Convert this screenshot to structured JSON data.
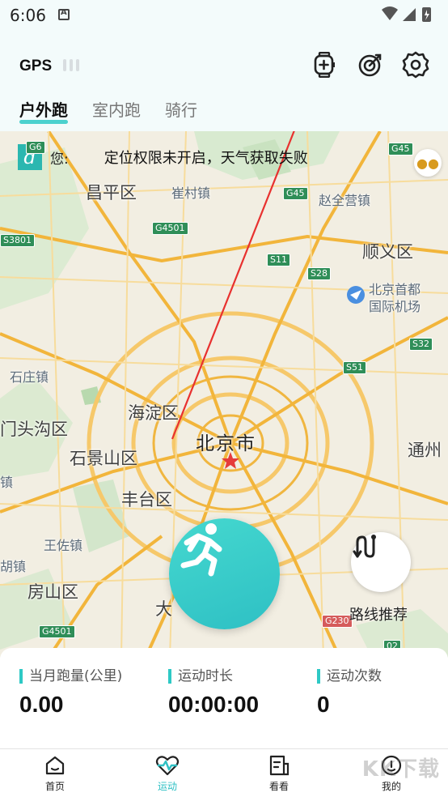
{
  "status_bar": {
    "time": "6:06"
  },
  "header": {
    "gps_label": "GPS",
    "tabs": [
      {
        "label": "户外跑",
        "active": true
      },
      {
        "label": "室内跑",
        "active": false
      },
      {
        "label": "骑行",
        "active": false
      }
    ],
    "icons": [
      "watch-add-icon",
      "target-icon",
      "settings-icon"
    ]
  },
  "map": {
    "weather_prefix": "您:",
    "weather_message": "定位权限未开启，天气获取失败",
    "city": "北京市",
    "districts": [
      "昌平区",
      "顺义区",
      "海淀区",
      "门头沟区",
      "石景山区",
      "丰台区",
      "房山区",
      "通州",
      "大"
    ],
    "towns": [
      "崔村镇",
      "赵全营镇",
      "北京首都",
      "国际机场",
      "王佐镇",
      "镇",
      "胡镇",
      "石庄镇"
    ],
    "road_shields": [
      "G6",
      "G45",
      "G4501",
      "G45",
      "S3801",
      "S11",
      "S28",
      "S32",
      "S51",
      "G4501",
      "G230",
      "02"
    ],
    "route_label": "路线推荐",
    "accent_color": "#2ec0c4",
    "annotation_arrow_color": "#e8312f"
  },
  "stats": [
    {
      "label": "当月跑量(公里)",
      "value": "0.00"
    },
    {
      "label": "运动时长",
      "value": "00:00:00"
    },
    {
      "label": "运动次数",
      "value": "0"
    }
  ],
  "bottom_nav": [
    {
      "label": "首页",
      "icon": "home-icon",
      "active": false
    },
    {
      "label": "运动",
      "icon": "heartbeat-icon",
      "active": true
    },
    {
      "label": "看看",
      "icon": "document-icon",
      "active": false
    },
    {
      "label": "我的",
      "icon": "profile-icon",
      "active": false
    }
  ],
  "watermark": "KK下载"
}
